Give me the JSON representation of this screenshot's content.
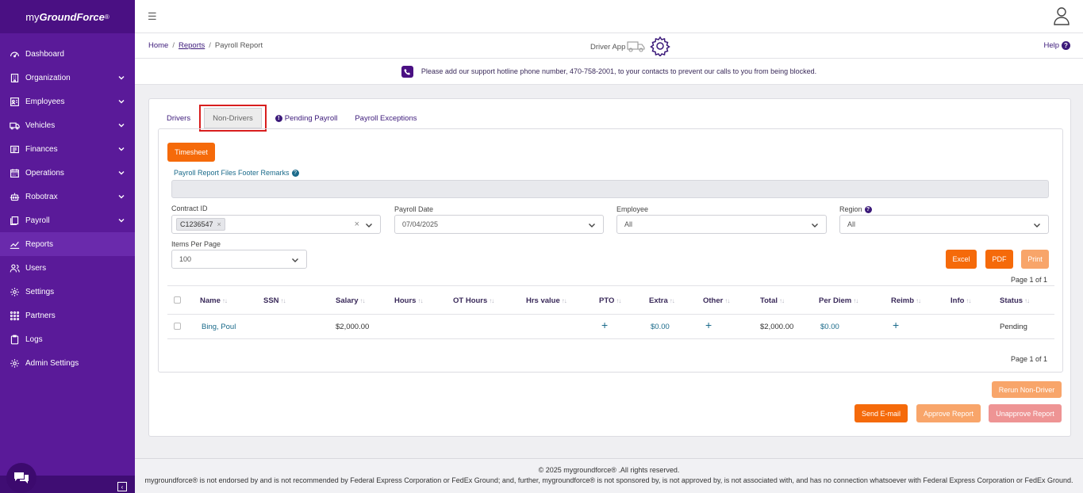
{
  "brand": {
    "prefix": "my",
    "bold": "GroundForce",
    "mark": "®"
  },
  "sidebar": {
    "items": [
      {
        "label": "Dashboard",
        "icon": "dashboard-icon",
        "chevron": false
      },
      {
        "label": "Organization",
        "icon": "building-icon",
        "chevron": true
      },
      {
        "label": "Employees",
        "icon": "id-card-icon",
        "chevron": true
      },
      {
        "label": "Vehicles",
        "icon": "truck-icon",
        "chevron": true
      },
      {
        "label": "Finances",
        "icon": "ledger-icon",
        "chevron": true
      },
      {
        "label": "Operations",
        "icon": "calendar-icon",
        "chevron": true
      },
      {
        "label": "Robotrax",
        "icon": "robot-icon",
        "chevron": true
      },
      {
        "label": "Payroll",
        "icon": "document-icon",
        "chevron": true
      },
      {
        "label": "Reports",
        "icon": "chart-icon",
        "chevron": false,
        "active": true
      },
      {
        "label": "Users",
        "icon": "users-icon",
        "chevron": false
      },
      {
        "label": "Settings",
        "icon": "gear-icon",
        "chevron": false
      },
      {
        "label": "Partners",
        "icon": "grid-icon",
        "chevron": false
      },
      {
        "label": "Logs",
        "icon": "clipboard-icon",
        "chevron": false
      },
      {
        "label": "Admin Settings",
        "icon": "gear-icon",
        "chevron": false
      }
    ]
  },
  "breadcrumb": {
    "home": "Home",
    "reports": "Reports",
    "current": "Payroll Report",
    "sep": "/"
  },
  "header": {
    "driver_app": "Driver App",
    "help": "Help",
    "help_badge": "?"
  },
  "notice": {
    "text": "Please add our support hotline phone number, 470-758-2001, to your contacts to prevent our calls to you from being blocked."
  },
  "tabs": {
    "drivers": "Drivers",
    "non_drivers": "Non-Drivers",
    "pending_payroll": "Pending Payroll",
    "payroll_exceptions": "Payroll Exceptions"
  },
  "form": {
    "timesheet": "Timesheet",
    "remarks_label": "Payroll Report Files Footer Remarks",
    "contract_label": "Contract ID",
    "contract_chip": "C1236547",
    "payroll_date_label": "Payroll Date",
    "payroll_date": "07/04/2025",
    "employee_label": "Employee",
    "employee_value": "All",
    "region_label": "Region",
    "region_value": "All",
    "items_label": "Items Per Page",
    "items_value": "100"
  },
  "actions": {
    "excel": "Excel",
    "pdf": "PDF",
    "print": "Print"
  },
  "paging": {
    "top": "Page 1 of 1",
    "bottom": "Page 1 of 1"
  },
  "table": {
    "headers": {
      "name": "Name",
      "ssn": "SSN",
      "salary": "Salary",
      "hours": "Hours",
      "ot_hours": "OT Hours",
      "hrs_value": "Hrs value",
      "pto": "PTO",
      "extra": "Extra",
      "other": "Other",
      "total": "Total",
      "per_diem": "Per Diem",
      "reimb": "Reimb",
      "info": "Info",
      "status": "Status"
    },
    "rows": [
      {
        "name": "Bing, Poul",
        "salary": "$2,000.00",
        "pto": "+",
        "extra": "$0.00",
        "other": "+",
        "total": "$2,000.00",
        "per_diem": "$0.00",
        "reimb": "+",
        "status": "Pending"
      }
    ]
  },
  "bottom_actions": {
    "rerun": "Rerun Non-Driver",
    "send_email": "Send E-mail",
    "approve": "Approve Report",
    "unapprove": "Unapprove Report"
  },
  "footer": {
    "line1": "© 2025 mygroundforce® .All rights reserved.",
    "line2": "mygroundforce® is not endorsed by and is not recommended by Federal Express Corporation or FedEx Ground; and, further, mygroundforce® is not sponsored by, is not approved by, is not associated with, and has no connection whatsoever with Federal Express Corporation or FedEx Ground."
  },
  "colors": {
    "sidebar": "#5a1a99",
    "accent_orange": "#f56a0a",
    "link": "#1a6a8a",
    "highlight": "#d81e1e"
  }
}
